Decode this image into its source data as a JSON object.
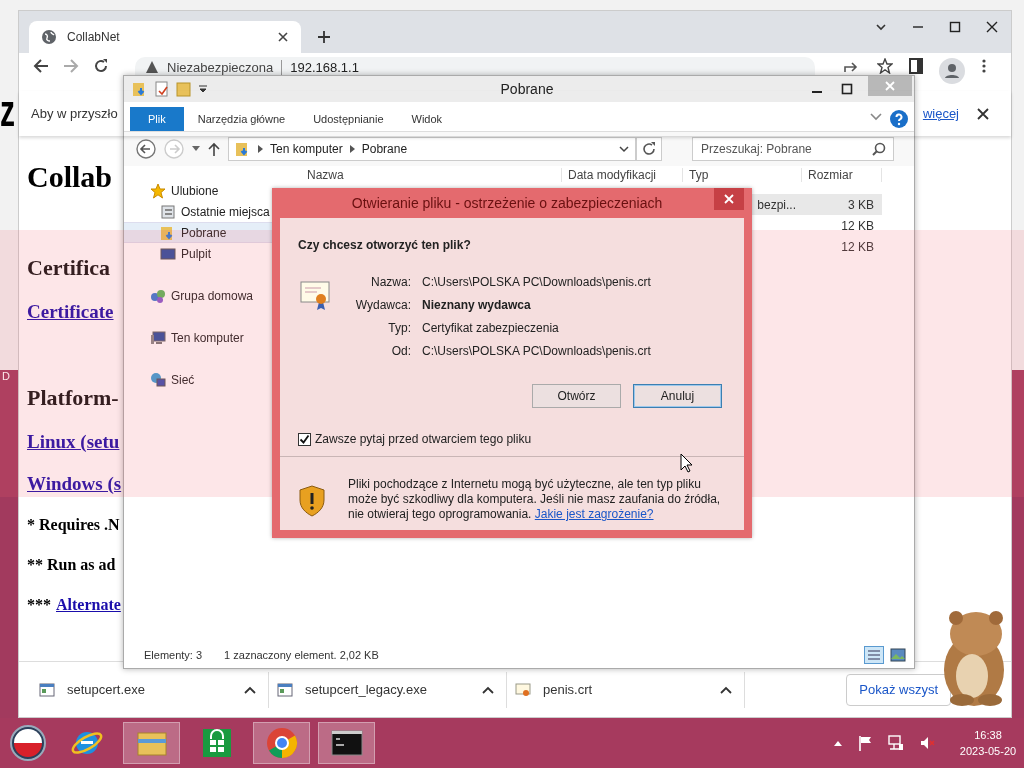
{
  "desktop": {
    "texts": [
      "z",
      "D"
    ]
  },
  "browser": {
    "tab": {
      "title": "CollabNet"
    },
    "omnibox": {
      "security": "Niezabezpieczona",
      "url": "192.168.1.1"
    },
    "infobar": {
      "text": "Aby w przyszło",
      "link": "więcej"
    },
    "page": {
      "blocks": [
        {
          "kind": "h1",
          "text": "Collab"
        },
        {
          "kind": "h2",
          "text": "Certifica"
        },
        {
          "kind": "link",
          "text": "Certificate"
        },
        {
          "kind": "h2",
          "text": "Platform-"
        },
        {
          "kind": "link",
          "text": "Linux (setu"
        },
        {
          "kind": "link",
          "text": "Windows (s"
        },
        {
          "kind": "note",
          "text": "* Requires .N"
        },
        {
          "kind": "note",
          "text": "** Run as ad"
        },
        {
          "kind": "note",
          "text": "***",
          "link": "Alternate"
        }
      ]
    },
    "downloads": {
      "items": [
        {
          "name": "setupcert.exe",
          "kind": "exe"
        },
        {
          "name": "setupcert_legacy.exe",
          "kind": "exe"
        },
        {
          "name": "penis.crt",
          "kind": "cert"
        }
      ],
      "show_all": "Pokaż wszyst"
    }
  },
  "explorer": {
    "title": "Pobrane",
    "ribbon_tabs": [
      {
        "label": "Plik",
        "selected": true
      },
      {
        "label": "Narzędzia główne",
        "selected": false
      },
      {
        "label": "Udostępnianie",
        "selected": false
      },
      {
        "label": "Widok",
        "selected": false
      }
    ],
    "breadcrumb": [
      "Ten komputer",
      "Pobrane"
    ],
    "search": {
      "placeholder": "Przeszukaj: Pobrane"
    },
    "nav": [
      {
        "label": "Ulubione",
        "kind": "star",
        "selected": false,
        "children": [
          {
            "label": "Ostatnie miejsca",
            "kind": "recent",
            "selected": false
          },
          {
            "label": "Pobrane",
            "kind": "downloads",
            "selected": true
          },
          {
            "label": "Pulpit",
            "kind": "desktop",
            "selected": false
          }
        ]
      },
      {
        "label": "Grupa domowa",
        "kind": "homegroup",
        "selected": false
      },
      {
        "label": "Ten komputer",
        "kind": "computer",
        "selected": false
      },
      {
        "label": "Sieć",
        "kind": "network",
        "selected": false
      }
    ],
    "columns": [
      "Nazwa",
      "Data modyfikacji",
      "Typ",
      "Rozmiar"
    ],
    "rows": [
      {
        "type": "bezpi...",
        "size": "3 KB",
        "selected": true
      },
      {
        "size": "12 KB",
        "selected": false
      },
      {
        "size": "12 KB",
        "selected": false
      }
    ],
    "status": {
      "count": "Elementy: 3",
      "selection": "1 zaznaczony element. 2,02 KB"
    }
  },
  "dialog": {
    "title": "Otwieranie pliku - ostrzeżenie o zabezpieczeniach",
    "question": "Czy chcesz otworzyć ten plik?",
    "fields": [
      {
        "label": "Nazwa:",
        "value": "C:\\Users\\POLSKA PC\\Downloads\\penis.crt",
        "bold": false
      },
      {
        "label": "Wydawca:",
        "value": "Nieznany wydawca",
        "bold": true
      },
      {
        "label": "Typ:",
        "value": "Certyfikat zabezpieczenia",
        "bold": false
      },
      {
        "label": "Od:",
        "value": "C:\\Users\\POLSKA PC\\Downloads\\penis.crt",
        "bold": false
      }
    ],
    "buttons": [
      {
        "label": "Otwórz",
        "focused": false
      },
      {
        "label": "Anuluj",
        "focused": true
      }
    ],
    "checkbox": {
      "label": "Zawsze pytaj przed otwarciem tego pliku",
      "checked": true
    },
    "warning": "Pliki pochodzące z Internetu mogą być użyteczne, ale ten typ pliku może być szkodliwy dla komputera. Jeśli nie masz zaufania do źródła, nie otwieraj tego oprogramowania.",
    "warning_link": "Jakie jest zagrożenie?"
  },
  "taskbar": {
    "apps": [
      {
        "kind": "start",
        "active": false
      },
      {
        "kind": "ie",
        "active": false
      },
      {
        "kind": "explorer",
        "active": true
      },
      {
        "kind": "store",
        "active": false
      },
      {
        "kind": "chrome",
        "active": true
      },
      {
        "kind": "cmd",
        "active": true
      }
    ],
    "clock": {
      "time": "16:38",
      "date": "2023-05-20"
    }
  }
}
